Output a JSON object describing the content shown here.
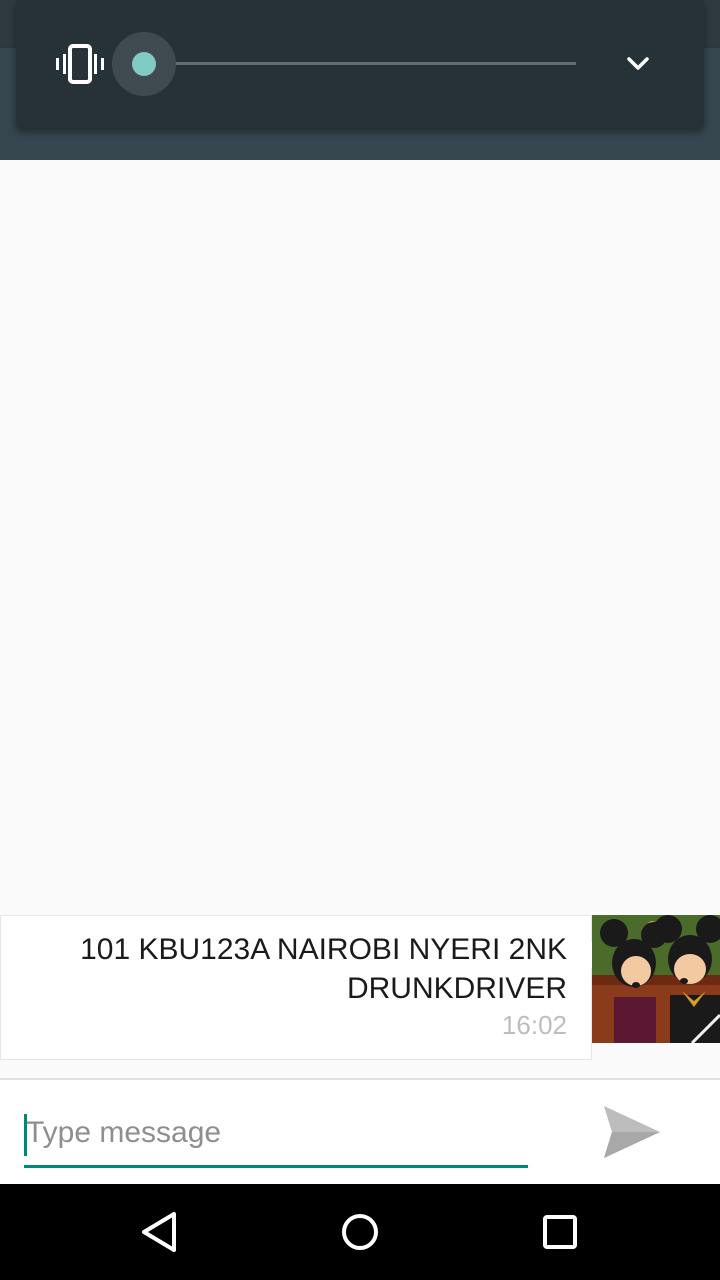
{
  "volume_panel": {
    "mode_icon": "vibrate-icon",
    "level": 0,
    "expand_icon": "chevron-down-icon"
  },
  "conversation": {
    "messages": [
      {
        "text": "101 KBU123A NAIROBI NYERI 2NK DRUNKDRIVER",
        "time": "16:02",
        "avatar": "mickey-minnie-photo"
      }
    ]
  },
  "composer": {
    "placeholder": "Type message",
    "value": "",
    "send_icon": "send-icon"
  },
  "navbar": {
    "back_icon": "back-icon",
    "home_icon": "home-icon",
    "recents_icon": "recents-icon"
  },
  "colors": {
    "accent": "#00897b",
    "slider_thumb": "#80cbc4",
    "app_bar": "#37474f",
    "panel": "#263238"
  }
}
